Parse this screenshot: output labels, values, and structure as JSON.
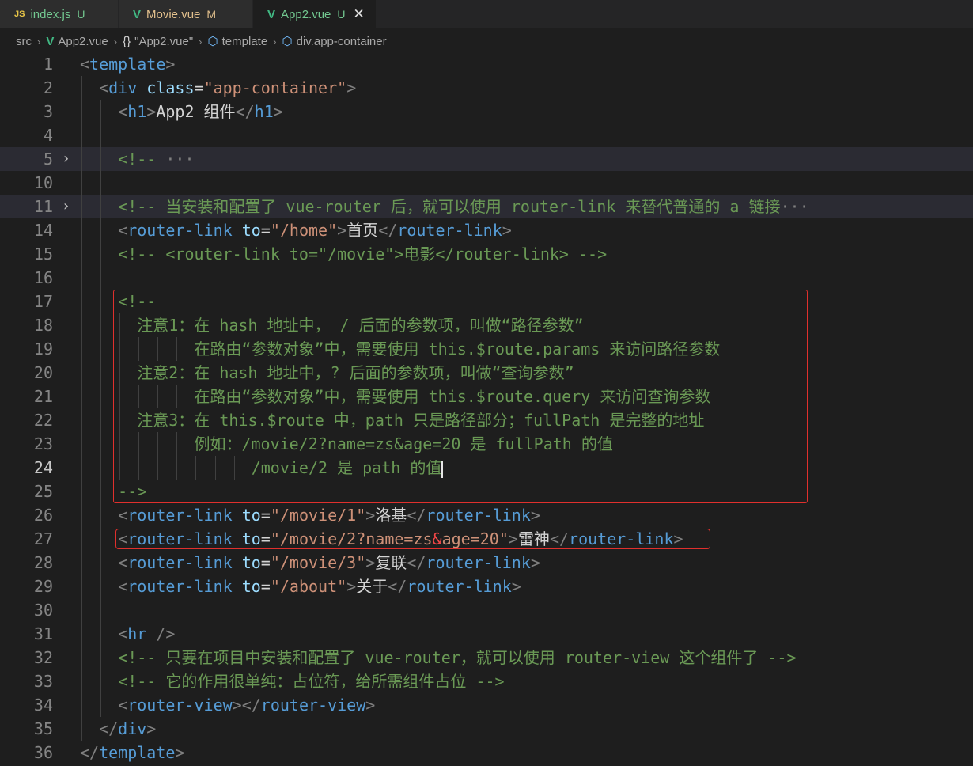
{
  "tabs": [
    {
      "icon": "JS",
      "name": "index.js",
      "status": "U"
    },
    {
      "icon": "V",
      "name": "Movie.vue",
      "status": "M"
    },
    {
      "icon": "V",
      "name": "App2.vue",
      "status": "U",
      "close": "✕"
    }
  ],
  "breadcrumb": {
    "folder": "src",
    "file": "App2.vue",
    "braces": "{}",
    "component": "\"App2.vue\"",
    "template": "template",
    "element": "div.app-container",
    "sep": "›"
  },
  "fold_arrow": "›",
  "lines": [
    {
      "n": "1",
      "ind": 0,
      "segs": [
        [
          "tg",
          "<"
        ],
        [
          "tn",
          "template"
        ],
        [
          "tg",
          ">"
        ]
      ]
    },
    {
      "n": "2",
      "ind": 1,
      "segs": [
        [
          "tg",
          "<"
        ],
        [
          "tn",
          "div"
        ],
        [
          "tx",
          " "
        ],
        [
          "at",
          "class"
        ],
        [
          "tx",
          "="
        ],
        [
          "sv",
          "\"app-container\""
        ],
        [
          "tg",
          ">"
        ]
      ]
    },
    {
      "n": "3",
      "ind": 2,
      "segs": [
        [
          "tg",
          "<"
        ],
        [
          "tn",
          "h1"
        ],
        [
          "tg",
          ">"
        ],
        [
          "tx",
          "App2 组件"
        ],
        [
          "tg",
          "</"
        ],
        [
          "tn",
          "h1"
        ],
        [
          "tg",
          ">"
        ]
      ]
    },
    {
      "n": "4",
      "ind": 2,
      "segs": []
    },
    {
      "n": "5",
      "ind": 2,
      "folded": true,
      "segs": [
        [
          "cm",
          "<!-- "
        ],
        [
          "tg",
          "···"
        ]
      ]
    },
    {
      "n": "10",
      "ind": 2,
      "segs": []
    },
    {
      "n": "11",
      "ind": 2,
      "folded": true,
      "segs": [
        [
          "cm",
          "<!-- 当安装和配置了 vue-router 后，就可以使用 router-link 来替代普通的 a 链接"
        ],
        [
          "tg",
          "···"
        ]
      ]
    },
    {
      "n": "14",
      "ind": 2,
      "segs": [
        [
          "tg",
          "<"
        ],
        [
          "tn",
          "router-link"
        ],
        [
          "tx",
          " "
        ],
        [
          "at",
          "to"
        ],
        [
          "tx",
          "="
        ],
        [
          "sv",
          "\"/home\""
        ],
        [
          "tg",
          ">"
        ],
        [
          "tx",
          "首页"
        ],
        [
          "tg",
          "</"
        ],
        [
          "tn",
          "router-link"
        ],
        [
          "tg",
          ">"
        ]
      ]
    },
    {
      "n": "15",
      "ind": 2,
      "segs": [
        [
          "cm",
          "<!-- <router-link to=\"/movie\">电影</router-link> -->"
        ]
      ]
    },
    {
      "n": "16",
      "ind": 2,
      "segs": []
    },
    {
      "n": "17",
      "ind": 2,
      "segs": [
        [
          "cm",
          "<!--"
        ]
      ]
    },
    {
      "n": "18",
      "ind": 3,
      "segs": [
        [
          "cm",
          "注意1：在 hash 地址中， / 后面的参数项，叫做“路径参数”"
        ]
      ]
    },
    {
      "n": "19",
      "ind": 6,
      "segs": [
        [
          "cm",
          "在路由“参数对象”中，需要使用 this.$route.params 来访问路径参数"
        ]
      ]
    },
    {
      "n": "20",
      "ind": 3,
      "segs": [
        [
          "cm",
          "注意2：在 hash 地址中，? 后面的参数项，叫做“查询参数”"
        ]
      ]
    },
    {
      "n": "21",
      "ind": 6,
      "segs": [
        [
          "cm",
          "在路由“参数对象”中，需要使用 this.$route.query 来访问查询参数"
        ]
      ]
    },
    {
      "n": "22",
      "ind": 3,
      "segs": [
        [
          "cm",
          "注意3：在 this.$route 中，path 只是路径部分；fullPath 是完整的地址"
        ]
      ]
    },
    {
      "n": "23",
      "ind": 6,
      "segs": [
        [
          "cm",
          "例如：/movie/2?name=zs&age=20 是 fullPath 的值"
        ]
      ]
    },
    {
      "n": "24",
      "ind": 9,
      "current": true,
      "segs": [
        [
          "cm",
          "/movie/2 是 path 的值"
        ]
      ]
    },
    {
      "n": "25",
      "ind": 2,
      "segs": [
        [
          "cm",
          "-->"
        ]
      ]
    },
    {
      "n": "26",
      "ind": 2,
      "segs": [
        [
          "tg",
          "<"
        ],
        [
          "tn",
          "router-link"
        ],
        [
          "tx",
          " "
        ],
        [
          "at",
          "to"
        ],
        [
          "tx",
          "="
        ],
        [
          "sv",
          "\"/movie/1\""
        ],
        [
          "tg",
          ">"
        ],
        [
          "tx",
          "洛基"
        ],
        [
          "tg",
          "</"
        ],
        [
          "tn",
          "router-link"
        ],
        [
          "tg",
          ">"
        ]
      ]
    },
    {
      "n": "27",
      "ind": 2,
      "segs": [
        [
          "tg",
          "<"
        ],
        [
          "tn",
          "router-link"
        ],
        [
          "tx",
          " "
        ],
        [
          "at",
          "to"
        ],
        [
          "tx",
          "="
        ],
        [
          "sv",
          "\"/movie/2?name=zs"
        ],
        [
          "amp",
          "&"
        ],
        [
          "sv",
          "age=20\""
        ],
        [
          "tg",
          ">"
        ],
        [
          "tx",
          "雷神"
        ],
        [
          "tg",
          "</"
        ],
        [
          "tn",
          "router-link"
        ],
        [
          "tg",
          ">"
        ]
      ]
    },
    {
      "n": "28",
      "ind": 2,
      "segs": [
        [
          "tg",
          "<"
        ],
        [
          "tn",
          "router-link"
        ],
        [
          "tx",
          " "
        ],
        [
          "at",
          "to"
        ],
        [
          "tx",
          "="
        ],
        [
          "sv",
          "\"/movie/3\""
        ],
        [
          "tg",
          ">"
        ],
        [
          "tx",
          "复联"
        ],
        [
          "tg",
          "</"
        ],
        [
          "tn",
          "router-link"
        ],
        [
          "tg",
          ">"
        ]
      ]
    },
    {
      "n": "29",
      "ind": 2,
      "segs": [
        [
          "tg",
          "<"
        ],
        [
          "tn",
          "router-link"
        ],
        [
          "tx",
          " "
        ],
        [
          "at",
          "to"
        ],
        [
          "tx",
          "="
        ],
        [
          "sv",
          "\"/about\""
        ],
        [
          "tg",
          ">"
        ],
        [
          "tx",
          "关于"
        ],
        [
          "tg",
          "</"
        ],
        [
          "tn",
          "router-link"
        ],
        [
          "tg",
          ">"
        ]
      ]
    },
    {
      "n": "30",
      "ind": 2,
      "segs": []
    },
    {
      "n": "31",
      "ind": 2,
      "segs": [
        [
          "tg",
          "<"
        ],
        [
          "tn",
          "hr"
        ],
        [
          "tx",
          " "
        ],
        [
          "tg",
          "/>"
        ]
      ]
    },
    {
      "n": "32",
      "ind": 2,
      "segs": [
        [
          "cm",
          "<!-- 只要在项目中安装和配置了 vue-router，就可以使用 router-view 这个组件了 -->"
        ]
      ]
    },
    {
      "n": "33",
      "ind": 2,
      "segs": [
        [
          "cm",
          "<!-- 它的作用很单纯：占位符，给所需组件占位 -->"
        ]
      ]
    },
    {
      "n": "34",
      "ind": 2,
      "segs": [
        [
          "tg",
          "<"
        ],
        [
          "tn",
          "router-view"
        ],
        [
          "tg",
          "></"
        ],
        [
          "tn",
          "router-view"
        ],
        [
          "tg",
          ">"
        ]
      ]
    },
    {
      "n": "35",
      "ind": 1,
      "segs": [
        [
          "tg",
          "</"
        ],
        [
          "tn",
          "div"
        ],
        [
          "tg",
          ">"
        ]
      ]
    },
    {
      "n": "36",
      "ind": 0,
      "segs": [
        [
          "tg",
          "</"
        ],
        [
          "tn",
          "template"
        ],
        [
          "tg",
          ">"
        ]
      ]
    }
  ]
}
